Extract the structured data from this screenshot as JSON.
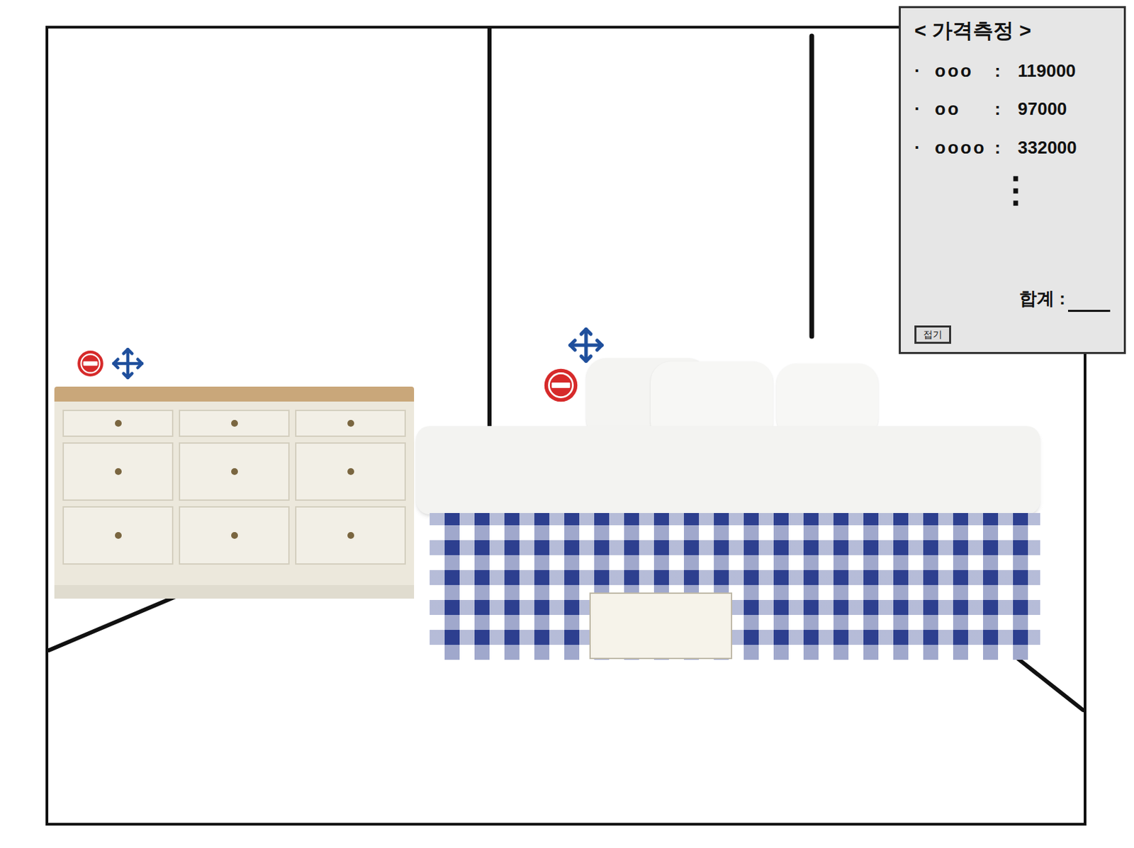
{
  "panel": {
    "title": "< 가격측정 >",
    "bullet": "·",
    "separator": ":",
    "items": [
      {
        "name": "ooo",
        "price": "119000"
      },
      {
        "name": "oo",
        "price": "97000"
      },
      {
        "name": "oooo",
        "price": "332000"
      }
    ],
    "ellipsis": "⋮",
    "total_label": "합계 :",
    "total_value": "",
    "collapse_button": "접기"
  },
  "furniture": [
    {
      "kind": "dresser"
    },
    {
      "kind": "bed"
    }
  ]
}
